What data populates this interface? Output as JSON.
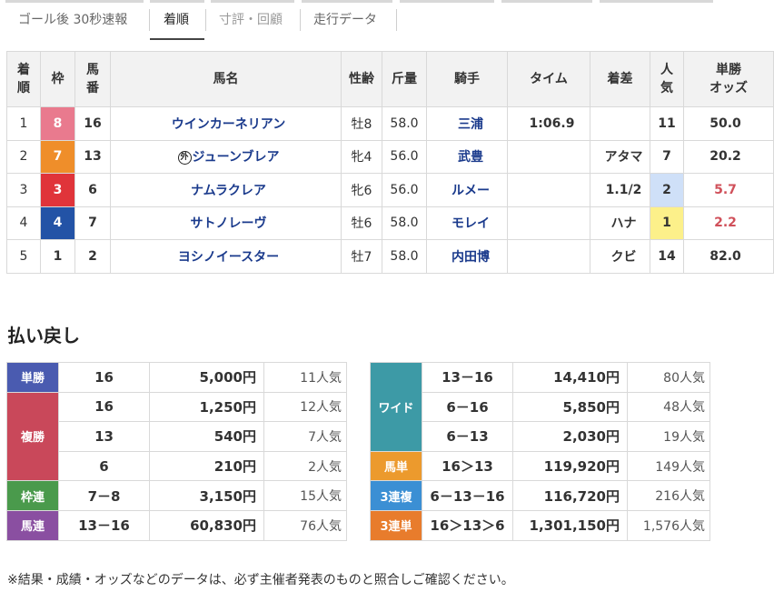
{
  "tabs": {
    "items": [
      {
        "label": "ゴール後 30秒速報"
      },
      {
        "label": "着順"
      },
      {
        "label": "寸評・回顧"
      },
      {
        "label": "走行データ"
      }
    ],
    "active": "着順"
  },
  "results": {
    "headers": {
      "rank": "着\n順",
      "waku": "枠",
      "num": "馬\n番",
      "name": "馬名",
      "sexage": "性齢",
      "weight": "斤量",
      "jockey": "騎手",
      "time": "タイム",
      "margin": "着差",
      "pop": "人\n気",
      "odds": "単勝\nオッズ"
    },
    "rows": [
      {
        "rank": "1",
        "waku": "8",
        "num": "16",
        "ext": "",
        "name": "ウインカーネリアン",
        "sexage": "牡8",
        "weight": "58.0",
        "jockey": "三浦",
        "time": "1:06.9",
        "margin": "",
        "pop": "11",
        "odds": "50.0"
      },
      {
        "rank": "2",
        "waku": "7",
        "num": "13",
        "ext": "外",
        "name": "ジューンブレア",
        "sexage": "牝4",
        "weight": "56.0",
        "jockey": "武豊",
        "time": "",
        "margin": "アタマ",
        "pop": "7",
        "odds": "20.2"
      },
      {
        "rank": "3",
        "waku": "3",
        "num": "6",
        "ext": "",
        "name": "ナムラクレア",
        "sexage": "牝6",
        "weight": "56.0",
        "jockey": "ルメー",
        "time": "",
        "margin": "1.1/2",
        "pop": "2",
        "odds": "5.7"
      },
      {
        "rank": "4",
        "waku": "4",
        "num": "7",
        "ext": "",
        "name": "サトノレーヴ",
        "sexage": "牡6",
        "weight": "58.0",
        "jockey": "モレイ",
        "time": "",
        "margin": "ハナ",
        "pop": "1",
        "odds": "2.2"
      },
      {
        "rank": "5",
        "waku": "1",
        "num": "2",
        "ext": "",
        "name": "ヨシノイースター",
        "sexage": "牡7",
        "weight": "58.0",
        "jockey": "内田博",
        "time": "",
        "margin": "クビ",
        "pop": "14",
        "odds": "82.0"
      }
    ]
  },
  "payout": {
    "title": "払い戻し",
    "tan": {
      "label": "単勝",
      "combo": "16",
      "amount": "5,000円",
      "ninki": "11人気"
    },
    "fuku": {
      "label": "複勝",
      "rows": [
        {
          "combo": "16",
          "amount": "1,250円",
          "ninki": "12人気"
        },
        {
          "combo": "13",
          "amount": "540円",
          "ninki": "7人気"
        },
        {
          "combo": "6",
          "amount": "210円",
          "ninki": "2人気"
        }
      ]
    },
    "wakuren": {
      "label": "枠連",
      "combo": "7－8",
      "amount": "3,150円",
      "ninki": "15人気"
    },
    "umaren": {
      "label": "馬連",
      "combo": "13－16",
      "amount": "60,830円",
      "ninki": "76人気"
    },
    "wide": {
      "label": "ワイド",
      "rows": [
        {
          "combo": "13－16",
          "amount": "14,410円",
          "ninki": "80人気"
        },
        {
          "combo": "6－16",
          "amount": "5,850円",
          "ninki": "48人気"
        },
        {
          "combo": "6－13",
          "amount": "2,030円",
          "ninki": "19人気"
        }
      ]
    },
    "umatan": {
      "label": "馬単",
      "combo": "16＞13",
      "amount": "119,920円",
      "ninki": "149人気"
    },
    "sanrenpuku": {
      "label": "3連複",
      "combo": "6－13－16",
      "amount": "116,720円",
      "ninki": "216人気"
    },
    "sanrentan": {
      "label": "3連単",
      "combo": "16＞13＞6",
      "amount": "1,301,150円",
      "ninki": "1,576人気"
    }
  },
  "note": "※結果・成績・オッズなどのデータは、必ず主催者発表のものと照合しご確認ください。",
  "colors": {
    "waku8": "#e97a8e",
    "waku7": "#ef8e2a",
    "waku3": "#e0343a",
    "waku4": "#2353a6",
    "pop1": "#fcf08a",
    "pop2": "#cfe0f8",
    "link": "#1a3a8c",
    "hot_odds": "#d0505a"
  }
}
